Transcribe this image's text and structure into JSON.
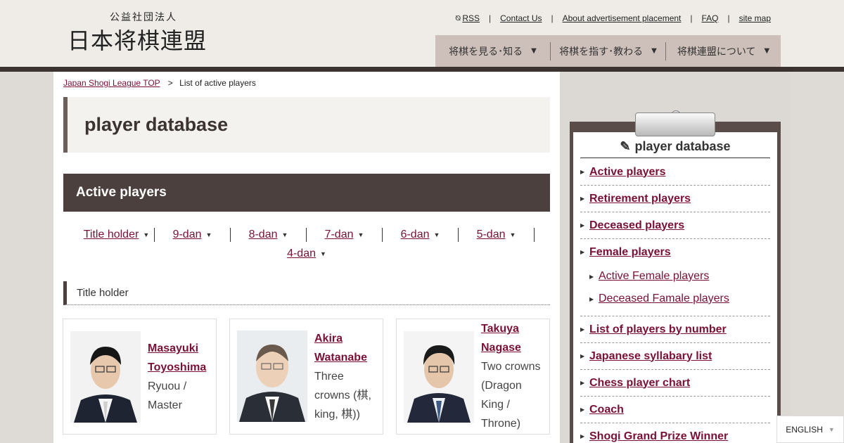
{
  "header": {
    "logo_sub": "公益社団法人",
    "logo_main": "日本将棋連盟",
    "util_links": [
      "RSS",
      "Contact Us",
      "About advertisement placement",
      "FAQ",
      "site map"
    ],
    "nav": [
      "将棋を見る･知る",
      "将棋を指す･教わる",
      "将棋連盟について"
    ]
  },
  "breadcrumb": {
    "home": "Japan Shogi League TOP",
    "separator": ">",
    "current": "List of active players"
  },
  "page_title": "player database",
  "section_title": "Active players",
  "dan_links": [
    "Title holder",
    "9-dan",
    "8-dan",
    "7-dan",
    "6-dan",
    "5-dan",
    "4-dan"
  ],
  "subsection_title": "Title holder",
  "players": [
    {
      "name_line1": "Masayuki",
      "name_line2": "Toyoshima",
      "titles": [
        "Ryuou /",
        "Master"
      ]
    },
    {
      "name_line1": "Akira",
      "name_line2": "Watanabe",
      "titles": [
        "Three",
        "crowns (棋,",
        "king, 棋))"
      ]
    },
    {
      "name_line1": "Takuya",
      "name_line2": "Nagase",
      "titles": [
        "Two crowns",
        "(Dragon",
        "King /",
        "Throne)"
      ]
    }
  ],
  "sidebar": {
    "title": "player database",
    "items": [
      {
        "label": "Active players"
      },
      {
        "label": "Retirement players"
      },
      {
        "label": "Deceased players"
      },
      {
        "label": "Female players",
        "sub": [
          "Active Female players",
          "Deceased Famale players"
        ]
      },
      {
        "label": "List of players by number"
      },
      {
        "label": "Japanese syllabary list"
      },
      {
        "label": "Chess player chart"
      },
      {
        "label": "Coach"
      },
      {
        "label": "Shogi Grand Prize Winner"
      }
    ]
  },
  "language": "ENGLISH",
  "colors": {
    "accent_link": "#7a1034",
    "dark_brown": "#4b403d",
    "nav_bg": "#cdbfb9"
  }
}
